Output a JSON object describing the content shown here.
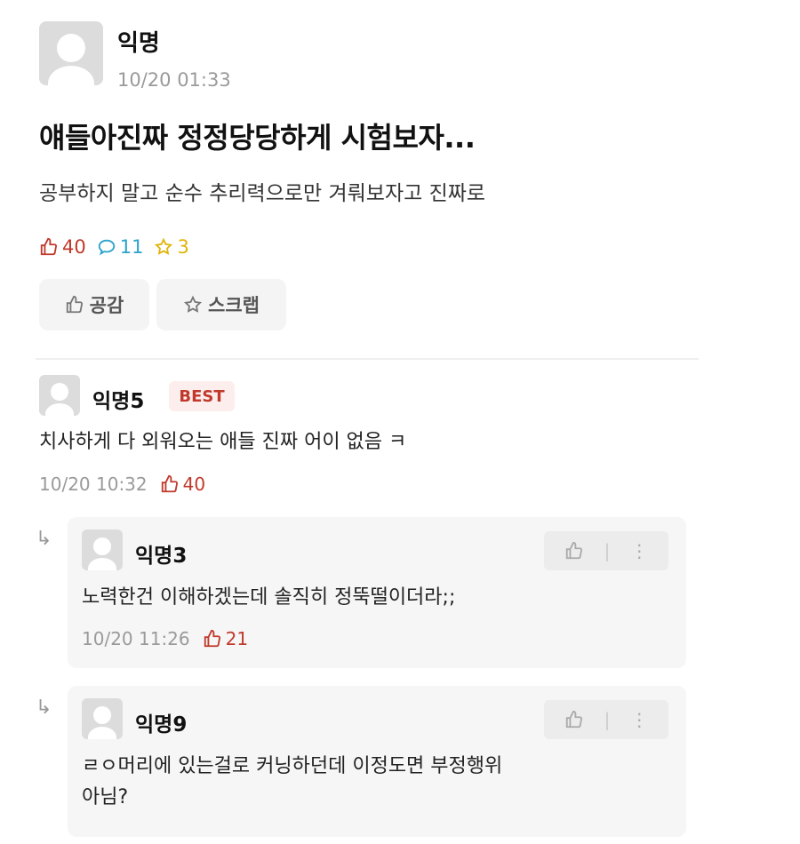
{
  "post": {
    "author": "익명",
    "time": "10/20 01:33",
    "title": "얘들아진짜 정정당당하게 시험보자...",
    "body": "공부하지 말고 순수 추리력으로만 겨뤄보자고 진짜로",
    "likes": "40",
    "comments": "11",
    "scraps": "3",
    "like_button": "공감",
    "scrap_button": "스크랩"
  },
  "comments": [
    {
      "author": "익명5",
      "badge": "BEST",
      "text": "치사하게 다 외워오는 애들 진짜 어이 없음 ㅋ",
      "time": "10/20 10:32",
      "likes": "40"
    }
  ],
  "replies": [
    {
      "author": "익명3",
      "text": "노력한건 이해하겠는데 솔직히 정뚝떨이더라;;",
      "time": "10/20 11:26",
      "likes": "21",
      "more": "⋮"
    },
    {
      "author": "익명9",
      "text_line1": "ㄹㅇ머리에 있는걸로 커닝하던데 이정도면 부정행위",
      "text_line2": "아님?",
      "more": "⋮"
    }
  ],
  "reply_arrow": "↳",
  "colors": {
    "like": "#c0392b",
    "comment": "#2aa3c9",
    "scrap": "#e0b40a",
    "muted": "#9a9a9a"
  }
}
